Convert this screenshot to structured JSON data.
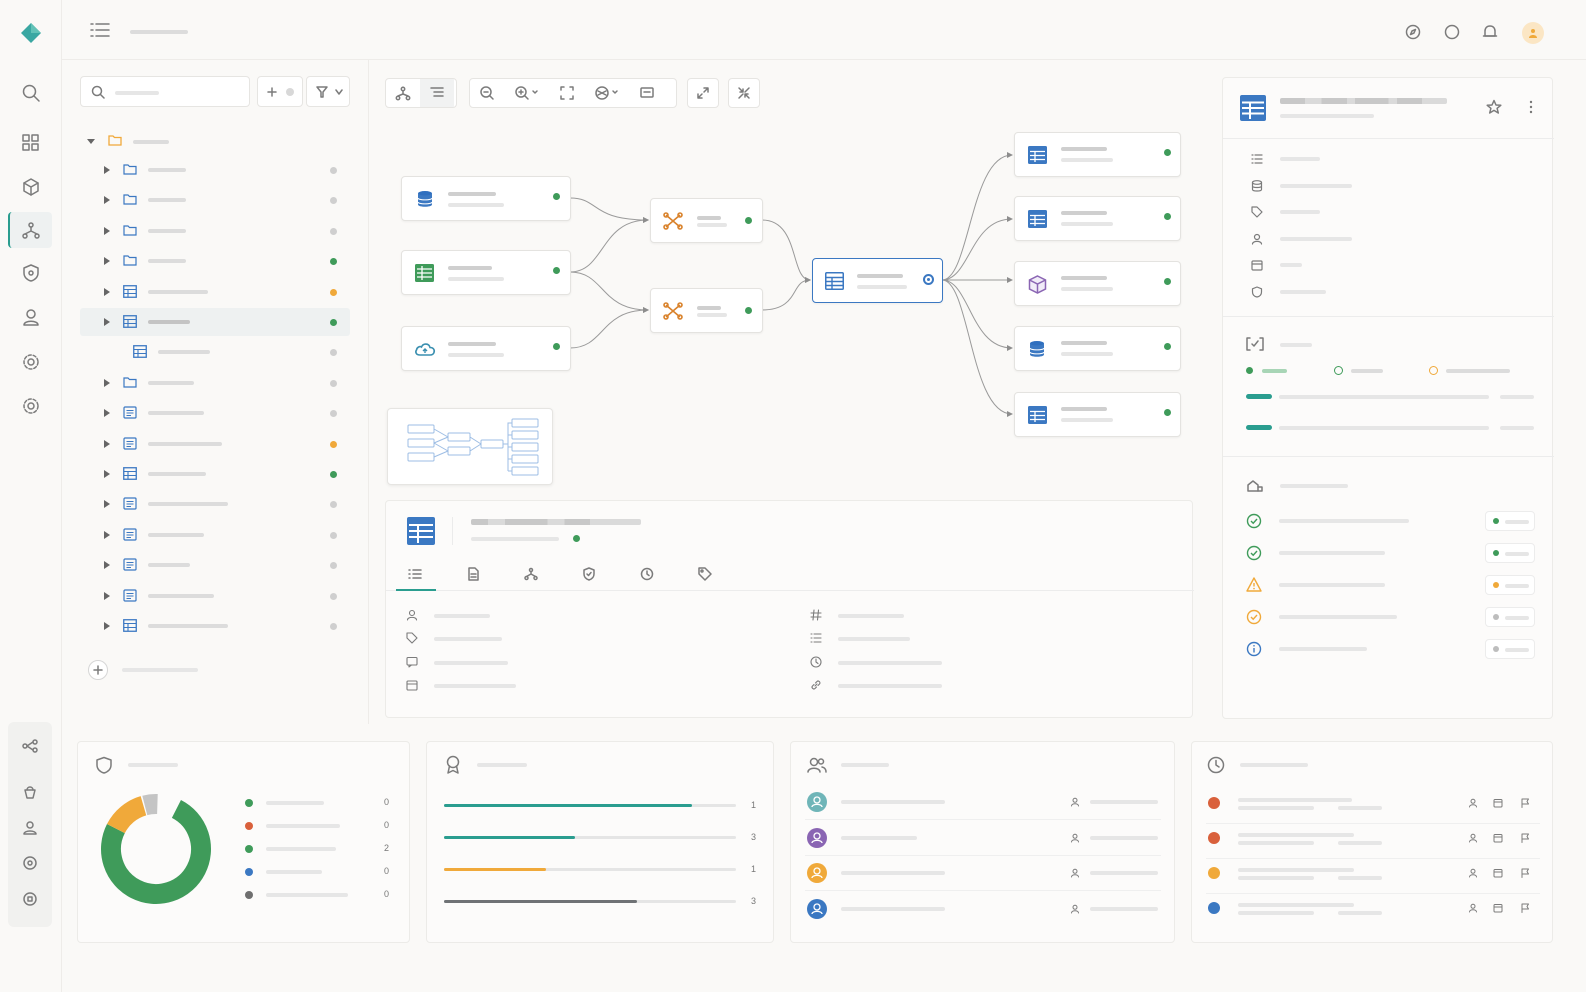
{
  "colors": {
    "accent_teal": "#2a9d8f",
    "green": "#3f9b5a",
    "orange": "#f0a93a",
    "blue": "#3b78c2",
    "red": "#d9603b",
    "gray": "#b5b5b5",
    "purple": "#8a65b3"
  },
  "sidebar": {
    "icons": [
      "logo-icon",
      "search-icon",
      "grid-icon",
      "cube-icon",
      "lineage-icon",
      "shield-icon",
      "user-icon",
      "gear-icon",
      "gear-alt-icon"
    ],
    "bottom_icons": [
      "flow-icon",
      "bucket-icon",
      "user-icon",
      "target-icon",
      "disc-icon"
    ]
  },
  "header": {
    "icons": [
      "menu-icon",
      "compass-icon",
      "circle-icon",
      "bell-icon",
      "avatar"
    ]
  },
  "tree": {
    "row_status": [
      "gray",
      "gray",
      "gray",
      "green",
      "orange",
      "green",
      "gray",
      "gray",
      "gray",
      "orange",
      "green",
      "gray",
      "gray",
      "gray",
      "gray",
      "gray"
    ]
  },
  "canvas": {
    "toolbar": [
      "graph-icon",
      "list-icon",
      "zoom-out-icon",
      "zoom-in-icon",
      "fit-icon",
      "layers-icon",
      "comment-icon",
      "expand-icon",
      "collapse-icon"
    ]
  },
  "bottom": {
    "donut": {
      "values": [
        0,
        0,
        2,
        0,
        0
      ]
    },
    "bars": {
      "values": [
        "1",
        "3",
        "1",
        "3"
      ],
      "fills": [
        0.85,
        0.45,
        0.35,
        0.66
      ]
    },
    "donut_labels": [
      "0",
      "0",
      "2",
      "0",
      "0"
    ]
  }
}
